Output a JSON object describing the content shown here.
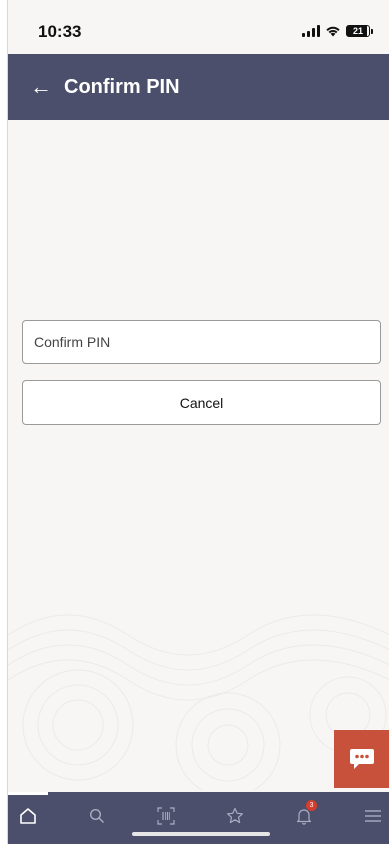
{
  "status_bar": {
    "time": "10:33",
    "battery": "21"
  },
  "header": {
    "back_icon": "arrow-left-icon",
    "title": "Confirm PIN"
  },
  "form": {
    "pin_placeholder": "Confirm PIN",
    "pin_value": "",
    "cancel_label": "Cancel"
  },
  "chat": {
    "icon": "chat-bubble-icon"
  },
  "bottom_nav": {
    "items": [
      {
        "icon": "home-icon",
        "active": true
      },
      {
        "icon": "search-icon"
      },
      {
        "icon": "barcode-scan-icon"
      },
      {
        "icon": "star-icon"
      },
      {
        "icon": "bell-icon",
        "badge": "3"
      },
      {
        "icon": "menu-icon"
      }
    ]
  },
  "colors": {
    "header_bg": "#4b4f6b",
    "page_bg": "#f7f6f4",
    "chat_fab": "#c7513b",
    "badge": "#d63c2b"
  }
}
